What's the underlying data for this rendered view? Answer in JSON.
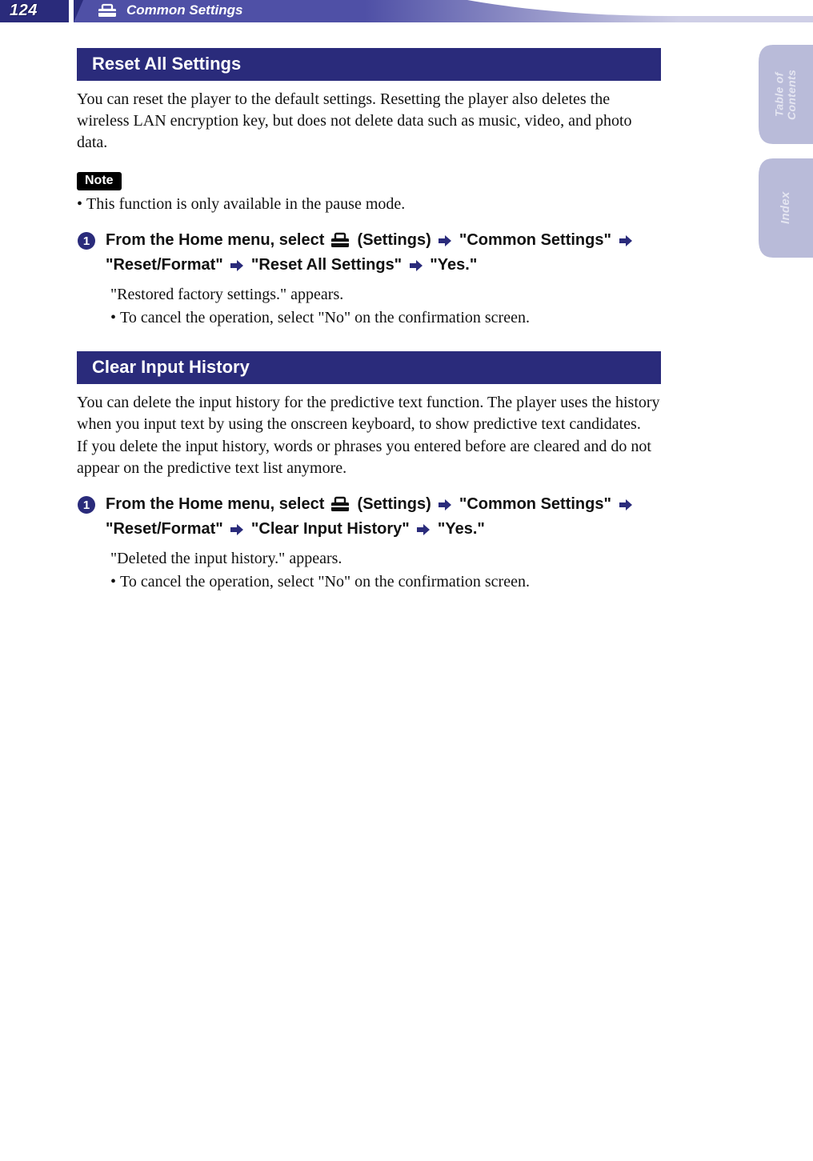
{
  "header": {
    "page_number": "124",
    "breadcrumb": "Common Settings"
  },
  "side_tabs": {
    "toc_line1": "Table of",
    "toc_line2": "Contents",
    "index": "Index"
  },
  "sections": {
    "reset": {
      "title": "Reset All Settings",
      "intro": "You can reset the player to the default settings. Resetting the player also deletes the wireless LAN encryption key, but does not delete data such as music, video, and photo data.",
      "note_label": "Note",
      "note_bullet": "This function is only available in the pause mode.",
      "step_prefix": "From the Home menu, select ",
      "step_settings_label": " (Settings) ",
      "step_s2": " \"Common Settings\" ",
      "step_s3": " \"Reset/Format\" ",
      "step_s4": " \"Reset All Settings\" ",
      "step_s5": " \"Yes.\"",
      "result_1": "\"Restored factory settings.\" appears.",
      "result_2": "To cancel the operation, select \"No\" on the confirmation screen."
    },
    "clear": {
      "title": "Clear Input History",
      "intro1": "You can delete the input history for the predictive text function. The player uses the history when you input text by using the onscreen keyboard, to show predictive text candidates.",
      "intro2": "If you delete the input history, words or phrases you entered before are cleared and do not appear on the predictive text list anymore.",
      "step_prefix": "From the Home menu, select ",
      "step_settings_label": " (Settings) ",
      "step_s2": " \"Common Settings\" ",
      "step_s3": " \"Reset/Format\" ",
      "step_s4": " \"Clear Input History\" ",
      "step_s5": " \"Yes.\"",
      "result_1": "\"Deleted the input history.\" appears.",
      "result_2": "To cancel the operation, select \"No\" on the confirmation screen."
    }
  }
}
